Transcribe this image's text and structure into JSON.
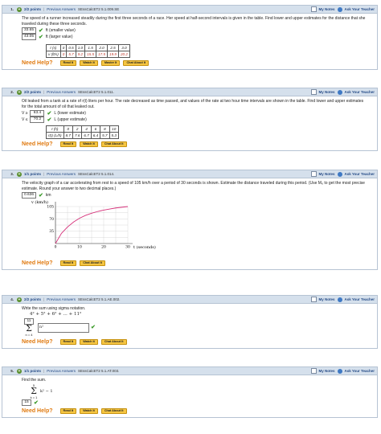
{
  "common": {
    "my_notes": "My Notes",
    "ask_teacher": "Ask Your Teacher",
    "need_help": "Need Help?",
    "read_it": "Read It",
    "watch_it": "Watch It",
    "master_it": "Master It",
    "chat_about_it": "Chat About It",
    "previous_answers": "Previous Answers"
  },
  "q1": {
    "num": "1.",
    "points": "2/2 points",
    "code": "SEssCalcET2 5.1.009.SE",
    "text": "The speed of a runner increased steadily during the first three seconds of a race. Her speed at half-second intervals is given in the table. Find lower and upper estimates for the distance that she traveled during these three seconds.",
    "lower_value": "33.65",
    "lower_label": "ft (smaller value)",
    "upper_value": "43.05",
    "upper_label": "ft (larger value)",
    "table": {
      "row1_label": "t (s)",
      "row1": [
        "0",
        "0.5",
        "1.0",
        "1.5",
        "2.0",
        "2.5",
        "3.0"
      ],
      "row2_label": "v (ft/s)",
      "row2": [
        "0",
        "5.7",
        "9.2",
        "15.5",
        "17.5",
        "19.9",
        "20.2"
      ]
    }
  },
  "q2": {
    "num": "2.",
    "points": "2/2 points",
    "code": "SEssCalcET2 5.1.011.",
    "text": "Oil leaked from a tank at a rate of r(t) liters per hour. The rate decreased as time passed, and values of the rate at two hour time intervals are shown in the table. Find lower and upper estimates for the total amount of oil that leaked out.",
    "lower_var": "V ≥",
    "lower_value": "63.4",
    "lower_label": "L (lower estimate)",
    "upper_var": "V ≤",
    "upper_value": "70.2",
    "upper_label": "L (upper estimate)",
    "table": {
      "row1_label": "t (h)",
      "row1": [
        "0",
        "2",
        "4",
        "6",
        "8",
        "10"
      ],
      "row2_label": "r(t) (L/h)",
      "row2": [
        "8.7",
        "7.6",
        "6.7",
        "6.4",
        "5.7",
        "5.3"
      ]
    }
  },
  "q3": {
    "num": "3.",
    "points": "1/1 points",
    "code": "SEssCalcET2 5.1.014.",
    "text": "The velocity graph of a car accelerating from rest to a speed of 105 km/h over a period of 30 seconds is shown. Estimate the distance traveled during this period. (Use M₆ to get the most precise estimate. Round your answer to two decimal places.)",
    "answer": "0.636",
    "unit": "km",
    "chart_data": {
      "type": "line",
      "ylabel": "v (km/h)",
      "xlabel": "t (seconds)",
      "x_ticks": [
        "0",
        "10",
        "20",
        "30"
      ],
      "y_ticks": [
        "35",
        "70",
        "105"
      ],
      "xlim": [
        0,
        30
      ],
      "ylim": [
        0,
        105
      ],
      "grid": true,
      "series": [
        {
          "x": [
            0,
            2.5,
            5,
            7.5,
            10,
            12.5,
            15,
            17.5,
            20,
            22.5,
            25,
            27.5,
            30
          ],
          "y": [
            0,
            29,
            47,
            61,
            72,
            80,
            86,
            91,
            95,
            98,
            101,
            103,
            105
          ]
        }
      ]
    }
  },
  "q4": {
    "num": "4.",
    "points": "2/2 points",
    "code": "SEssCalcET2 5.1.AE.002.",
    "text": "Write the sum using sigma notation.",
    "expression": "4² + 5² + 6² + … + 11²",
    "upper": "11",
    "lower": "n = 4",
    "term": "n²"
  },
  "q5": {
    "num": "5.",
    "points": "1/1 points",
    "code": "SEssCalcET2 5.1.AT.003.",
    "text": "Find the sum.",
    "upper": "5",
    "sum_term": "k² − 1",
    "lower": "k = 1",
    "answer": "15"
  }
}
